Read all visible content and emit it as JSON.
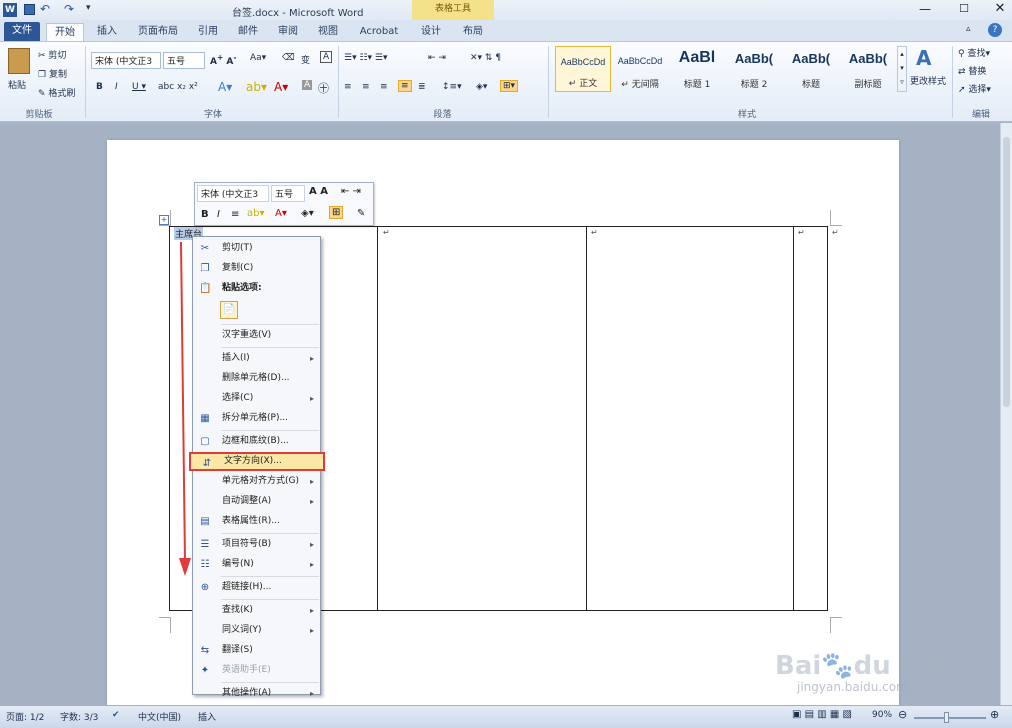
{
  "window": {
    "title": "台签.docx - Microsoft Word",
    "contextual_tab_group": "表格工具"
  },
  "tabs": [
    "文件",
    "开始",
    "插入",
    "页面布局",
    "引用",
    "邮件",
    "审阅",
    "视图",
    "Acrobat",
    "设计",
    "布局"
  ],
  "ribbon": {
    "clipboard": {
      "paste": "粘贴",
      "cut": "剪切",
      "copy": "复制",
      "format_painter": "格式刷",
      "label": "剪贴板"
    },
    "font": {
      "font_name": "宋体 (中文正3",
      "font_size": "五号",
      "label": "字体"
    },
    "paragraph": {
      "label": "段落"
    },
    "styles": {
      "label": "样式",
      "items": [
        {
          "preview": "AaBbCcDd",
          "name": "↵ 正文"
        },
        {
          "preview": "AaBbCcDd",
          "name": "↵ 无间隔"
        },
        {
          "preview": "AaBl",
          "name": "标题 1"
        },
        {
          "preview": "AaBb(",
          "name": "标题 2"
        },
        {
          "preview": "AaBb(",
          "name": "标题"
        },
        {
          "preview": "AaBb(",
          "name": "副标题"
        }
      ],
      "change_styles": "更改样式"
    },
    "editing": {
      "find": "查找",
      "replace": "替换",
      "select": "选择",
      "label": "编辑"
    }
  },
  "mini_toolbar": {
    "font_name": "宋体 (中文正3",
    "font_size": "五号"
  },
  "document": {
    "cell_text": "主席台"
  },
  "context_menu": [
    {
      "label": "剪切(T)",
      "icon": "scissors-icon"
    },
    {
      "label": "复制(C)",
      "icon": "copy-icon"
    },
    {
      "label": "粘贴选项:",
      "icon": "paste-icon",
      "bold": true
    },
    {
      "label": "",
      "icon": "paste-keep-text-icon",
      "type": "paste-buttons"
    },
    {
      "type": "sep"
    },
    {
      "label": "汉字重选(V)"
    },
    {
      "type": "sep"
    },
    {
      "label": "插入(I)",
      "submenu": true
    },
    {
      "label": "删除单元格(D)..."
    },
    {
      "label": "选择(C)",
      "submenu": true
    },
    {
      "label": "拆分单元格(P)...",
      "icon": "split-cells-icon"
    },
    {
      "type": "sep"
    },
    {
      "label": "边框和底纹(B)...",
      "icon": "borders-icon"
    },
    {
      "label": "文字方向(X)...",
      "icon": "text-direction-icon",
      "highlighted": true
    },
    {
      "label": "单元格对齐方式(G)",
      "submenu": true
    },
    {
      "label": "自动调整(A)",
      "submenu": true
    },
    {
      "label": "表格属性(R)...",
      "icon": "table-properties-icon"
    },
    {
      "type": "sep"
    },
    {
      "label": "项目符号(B)",
      "icon": "bullets-icon",
      "submenu": true
    },
    {
      "label": "编号(N)",
      "icon": "numbering-icon",
      "submenu": true
    },
    {
      "type": "sep"
    },
    {
      "label": "超链接(H)...",
      "icon": "hyperlink-icon"
    },
    {
      "type": "sep"
    },
    {
      "label": "查找(K)",
      "submenu": true
    },
    {
      "label": "同义词(Y)",
      "submenu": true
    },
    {
      "label": "翻译(S)",
      "icon": "translate-icon"
    },
    {
      "label": "英语助手(E)",
      "icon": "english-assistant-icon",
      "disabled": true
    },
    {
      "type": "sep"
    },
    {
      "label": "其他操作(A)",
      "submenu": true
    }
  ],
  "status": {
    "page": "页面: 1/2",
    "words": "字数: 3/3",
    "language": "中文(中国)",
    "mode": "插入",
    "zoom": "90%"
  },
  "watermark": {
    "text": "Bai du 经验",
    "url": "jingyan.baidu.com"
  },
  "colors": {
    "accent": "#2b5797",
    "highlight_border": "#e03a3a",
    "highlight_bg": "#fbe8a6",
    "arrow": "#e03a3a"
  }
}
